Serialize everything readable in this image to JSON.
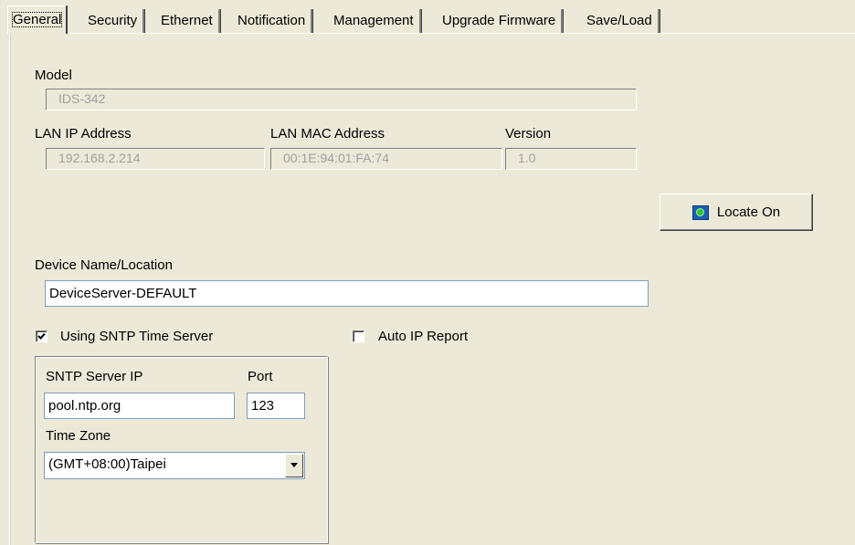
{
  "tabs": [
    "General",
    "Security",
    "Ethernet",
    "Notification",
    "Management",
    "Upgrade Firmware",
    "Save/Load"
  ],
  "active_tab": "General",
  "model": {
    "label": "Model",
    "value": "IDS-342"
  },
  "lan_ip": {
    "label": "LAN IP Address",
    "value": "192.168.2.214"
  },
  "lan_mac": {
    "label": "LAN MAC Address",
    "value": "00:1E:94:01:FA:74"
  },
  "version": {
    "label": "Version",
    "value": "1.0"
  },
  "locate_button": {
    "label": "Locate On",
    "icon": "locate-icon"
  },
  "device_name": {
    "label": "Device Name/Location",
    "value": "DeviceServer-DEFAULT"
  },
  "sntp_toggle": {
    "label": "Using SNTP Time Server",
    "checked": true
  },
  "auto_ip_report": {
    "label": "Auto IP Report",
    "checked": false
  },
  "sntp": {
    "server_label": "SNTP Server IP",
    "server_value": "pool.ntp.org",
    "port_label": "Port",
    "port_value": "123",
    "timezone_label": "Time Zone",
    "timezone_value": "(GMT+08:00)Taipei"
  }
}
